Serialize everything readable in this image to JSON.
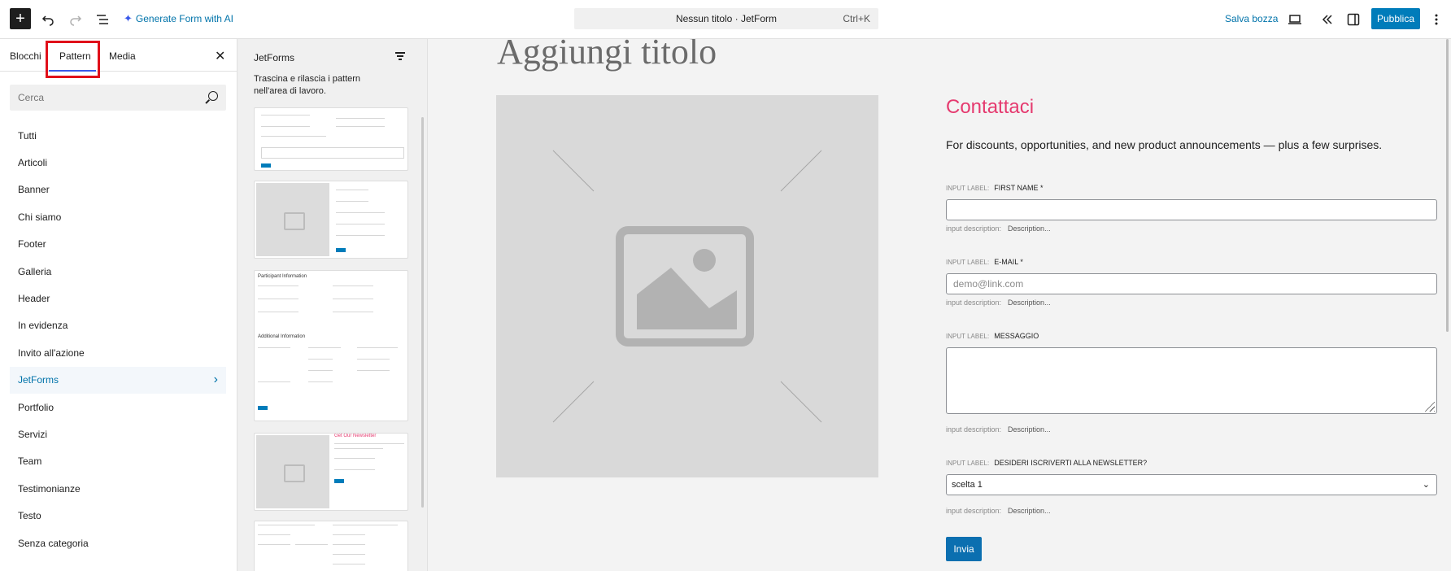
{
  "toolbar": {
    "add_block_label": "+",
    "undo_icon": "undo-icon",
    "redo_icon": "redo-icon",
    "list_view_icon": "list-view-icon",
    "ai_label": "Generate Form with AI",
    "command_title": "Nessun titolo · JetForm",
    "command_shortcut": "Ctrl+K",
    "save_draft_label": "Salva bozza",
    "preview_icon": "desktop-preview-icon",
    "collapse_icon": "double-chevron-left-icon",
    "settings_icon": "sidebar-toggle-icon",
    "publish_label": "Pubblica",
    "options_icon": "vertical-dots-icon"
  },
  "inserter": {
    "tabs": [
      "Blocchi",
      "Pattern",
      "Media"
    ],
    "active_tab": "Pattern",
    "highlight_color": "#e0101a",
    "search_placeholder": "Cerca",
    "categories": [
      "Tutti",
      "Articoli",
      "Banner",
      "Chi siamo",
      "Footer",
      "Galleria",
      "Header",
      "In evidenza",
      "Invito all'azione",
      "JetForms",
      "Portfolio",
      "Servizi",
      "Team",
      "Testimonianze",
      "Testo",
      "Senza categoria"
    ],
    "active_category": "JetForms"
  },
  "patterns": {
    "title": "JetForms",
    "hint": "Trascina e rilascia i pattern nell'area di lavoro.",
    "card_headers": {
      "card3_a": "Participant Information",
      "card3_b": "Additional Information",
      "card4": "Get Our Newsletter"
    }
  },
  "canvas": {
    "page_title": "Aggiungi titolo",
    "form": {
      "title": "Contattaci",
      "title_color": "#e53a6f",
      "subtitle": "For discounts, opportunities, and new product announcements — plus a few surprises.",
      "label_meta": "INPUT LABEL:",
      "desc_meta": "input description:",
      "desc_value": "Description...",
      "fields": {
        "first_name": "FIRST NAME *",
        "email": "E-MAIL *",
        "email_placeholder": "demo@link.com",
        "message": "MESSAGGIO",
        "newsletter": "DESIDERI ISCRIVERTI ALLA NEWSLETTER?",
        "newsletter_selected": "scelta 1"
      },
      "submit_label": "Invia"
    }
  }
}
